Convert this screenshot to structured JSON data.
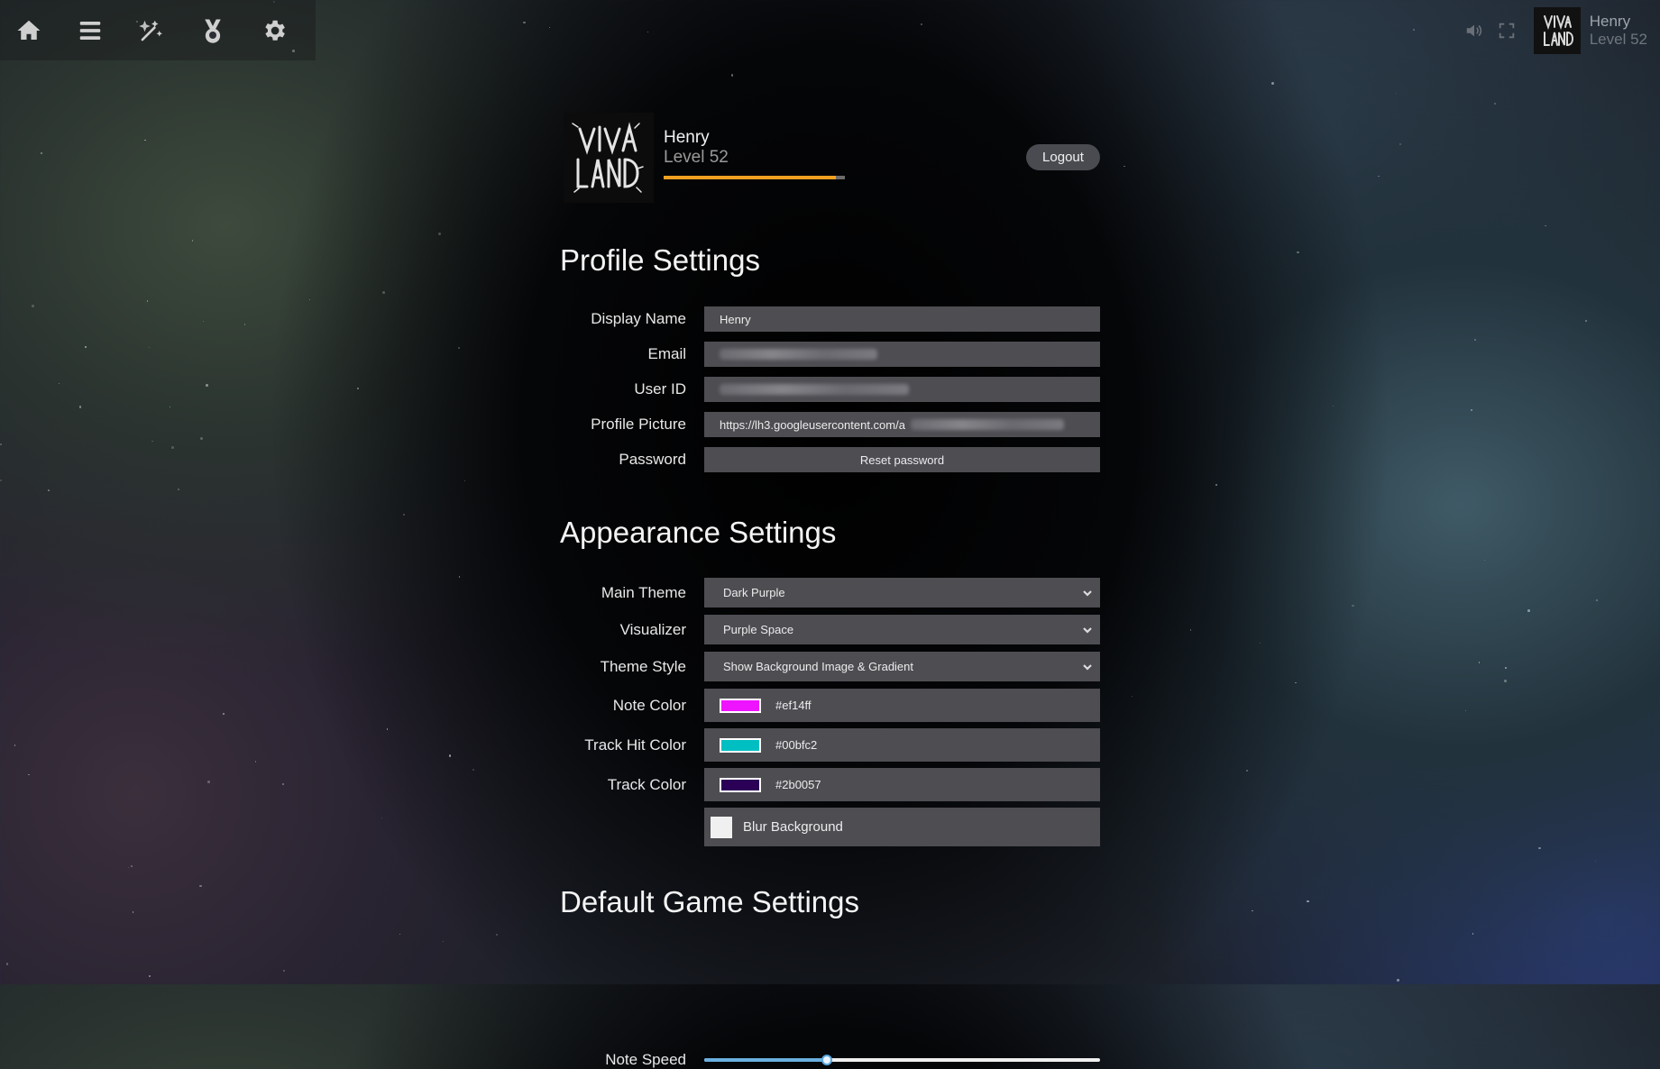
{
  "nav": {
    "icons": [
      "home-icon",
      "menu-list-icon",
      "editor-tools-icon",
      "medal-icon",
      "gear-icon"
    ]
  },
  "header": {
    "user_name": "Henry",
    "user_level": "Level 52",
    "volume_icon": "speaker-icon",
    "fullscreen_icon": "fullscreen-icon"
  },
  "profile": {
    "name": "Henry",
    "level": "Level 52",
    "xp_progress": 0.95,
    "logout_label": "Logout"
  },
  "profile_settings": {
    "title": "Profile Settings",
    "display_name_label": "Display Name",
    "display_name_value": "Henry",
    "email_label": "Email",
    "user_id_label": "User ID",
    "profile_picture_label": "Profile Picture",
    "profile_picture_value": "https://lh3.googleusercontent.com/a",
    "password_label": "Password",
    "reset_password_label": "Reset password"
  },
  "appearance_settings": {
    "title": "Appearance Settings",
    "main_theme_label": "Main Theme",
    "main_theme_value": "Dark Purple",
    "visualizer_label": "Visualizer",
    "visualizer_value": "Purple Space",
    "theme_style_label": "Theme Style",
    "theme_style_value": "Show Background Image & Gradient",
    "note_color_label": "Note Color",
    "note_color_value": "#ef14ff",
    "track_hit_color_label": "Track Hit Color",
    "track_hit_color_value": "#00bfc2",
    "track_color_label": "Track Color",
    "track_color_value": "#2b0057",
    "blur_background_label": "Blur Background"
  },
  "game_settings": {
    "title": "Default Game Settings",
    "note_speed_label": "Note Speed",
    "note_speed_fraction": 0.31
  },
  "colors": {
    "xp_bar": "#f0a020",
    "slider_accent": "#6ab0e0"
  }
}
